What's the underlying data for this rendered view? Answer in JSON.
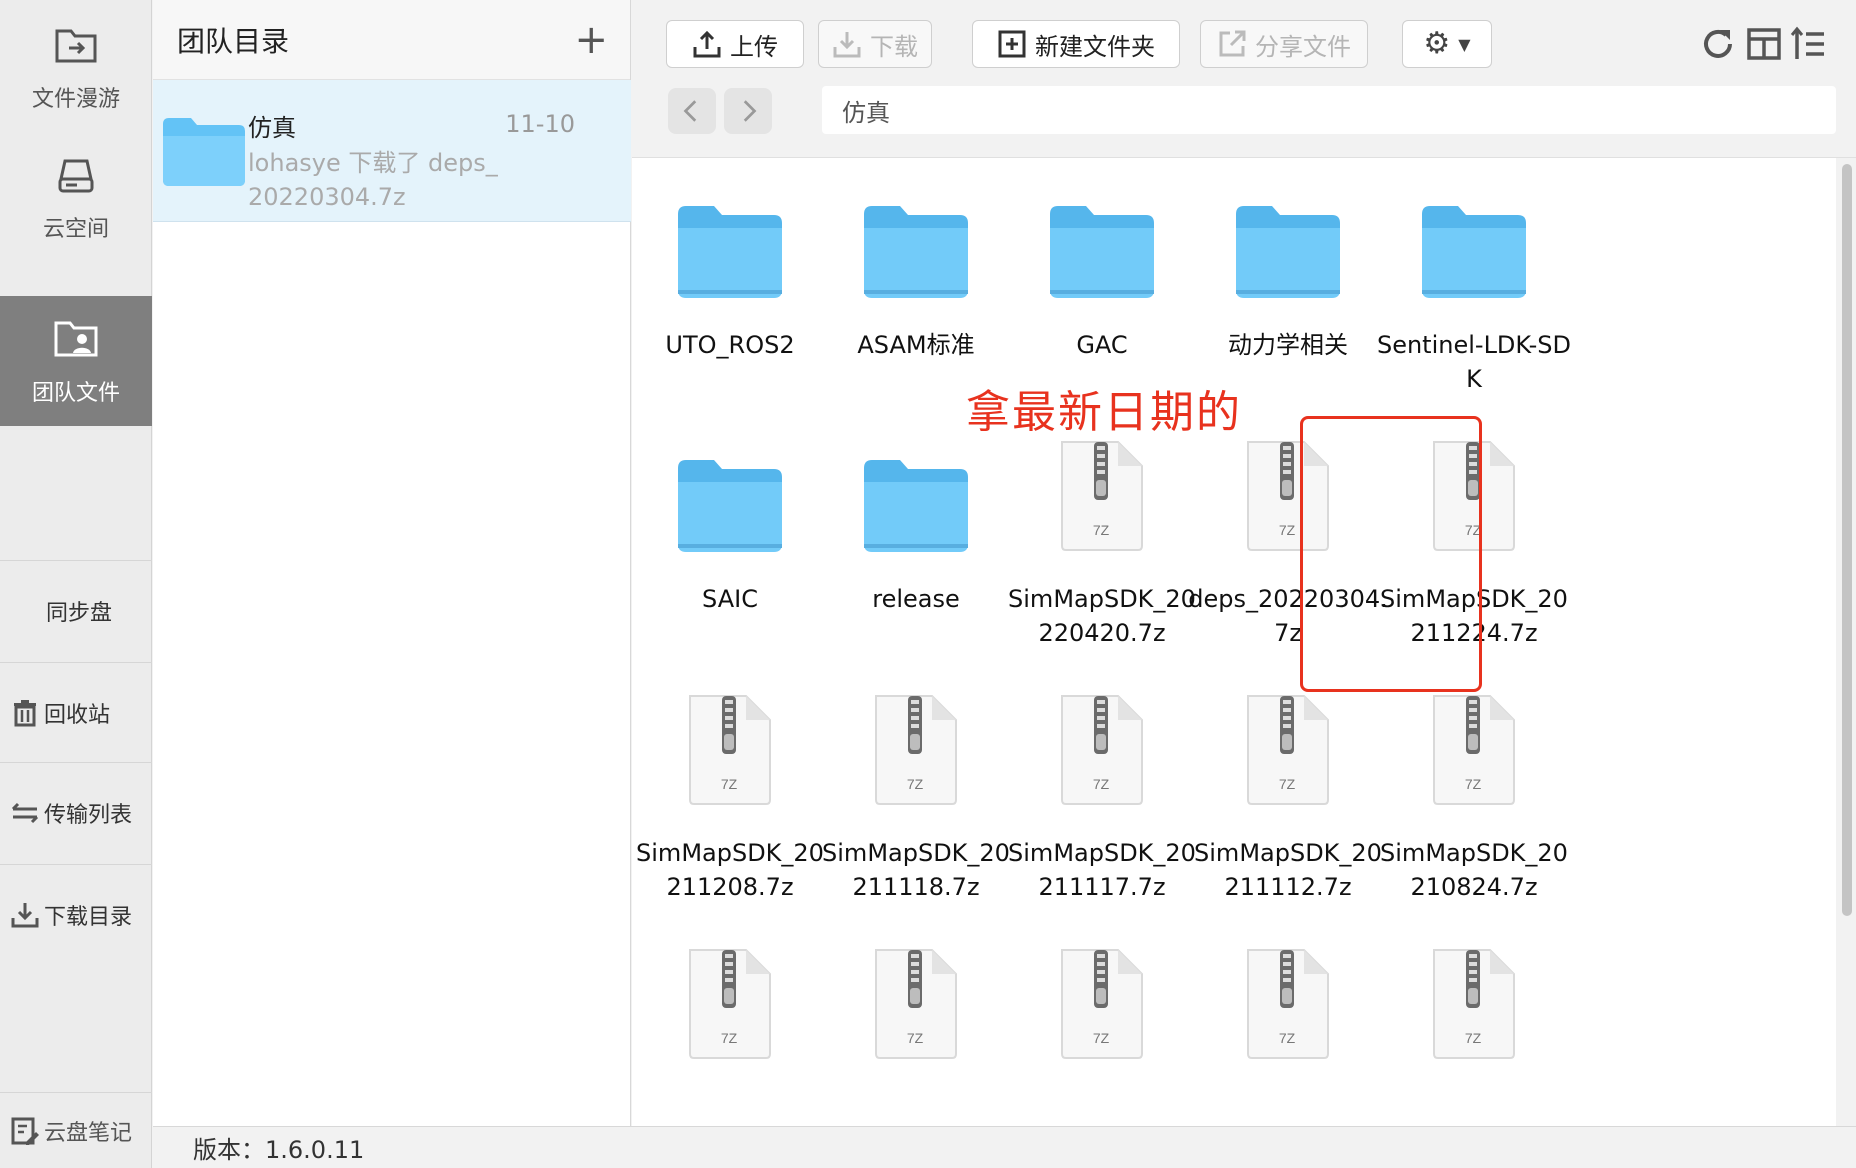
{
  "nav": {
    "top_items": [
      {
        "label": "文件漫游",
        "icon": "folder-export-icon"
      },
      {
        "label": "云空间",
        "icon": "cloud-drive-icon"
      },
      {
        "label": "团队文件",
        "icon": "team-folder-icon",
        "active": true
      }
    ],
    "bottom_items": [
      {
        "label": "同步盘"
      },
      {
        "label": "回收站",
        "icon": "trash-icon"
      },
      {
        "label": "传输列表",
        "icon": "transfer-arrows-icon"
      },
      {
        "label": "下载目录",
        "icon": "download-icon"
      }
    ],
    "notes_label": "云盘笔记"
  },
  "directory_panel": {
    "title": "团队目录",
    "add_icon": "plus-icon",
    "item": {
      "name": "仿真",
      "date": "11-10",
      "description": "lohasye 下载了 deps_20220304.7z"
    }
  },
  "toolbar": {
    "upload_label": "上传",
    "download_label": "下载",
    "new_folder_label": "新建文件夹",
    "share_label": "分享文件",
    "settings_icon": "gear-icon",
    "refresh_icon": "refresh-icon",
    "layout_icon": "split-layout-icon",
    "sort_icon": "sort-list-icon"
  },
  "breadcrumb": {
    "path": "仿真"
  },
  "files": [
    {
      "name": "UTO_ROS2",
      "type": "folder"
    },
    {
      "name": "ASAM标准",
      "type": "folder"
    },
    {
      "name": "GAC",
      "type": "folder"
    },
    {
      "name": "动力学相关",
      "type": "folder"
    },
    {
      "name": "Sentinel-LDK-SDK",
      "type": "folder"
    },
    {
      "name": "SAIC",
      "type": "folder"
    },
    {
      "name": "release",
      "type": "folder"
    },
    {
      "name": "SimMapSDK_20220420.7z",
      "type": "7z"
    },
    {
      "name": "deps_20220304.7z",
      "type": "7z"
    },
    {
      "name": "SimMapSDK_20211224.7z",
      "type": "7z"
    },
    {
      "name": "SimMapSDK_20211208.7z",
      "type": "7z"
    },
    {
      "name": "SimMapSDK_20211118.7z",
      "type": "7z"
    },
    {
      "name": "SimMapSDK_20211117.7z",
      "type": "7z"
    },
    {
      "name": "SimMapSDK_20211112.7z",
      "type": "7z"
    },
    {
      "name": "SimMapSDK_20210824.7z",
      "type": "7z"
    },
    {
      "name": "",
      "type": "7z"
    },
    {
      "name": "",
      "type": "7z"
    },
    {
      "name": "",
      "type": "7z"
    },
    {
      "name": "",
      "type": "7z"
    },
    {
      "name": "",
      "type": "7z"
    }
  ],
  "archive_badge": "7Z",
  "annotation": {
    "text": "拿最新日期的",
    "color": "#e8321e"
  },
  "status_bar": {
    "version_text": "版本：1.6.0.11"
  },
  "colors": {
    "accent_folder": "#5cbcf0",
    "active_nav": "#7f7f7f",
    "selected_row": "#e4f3fb"
  }
}
